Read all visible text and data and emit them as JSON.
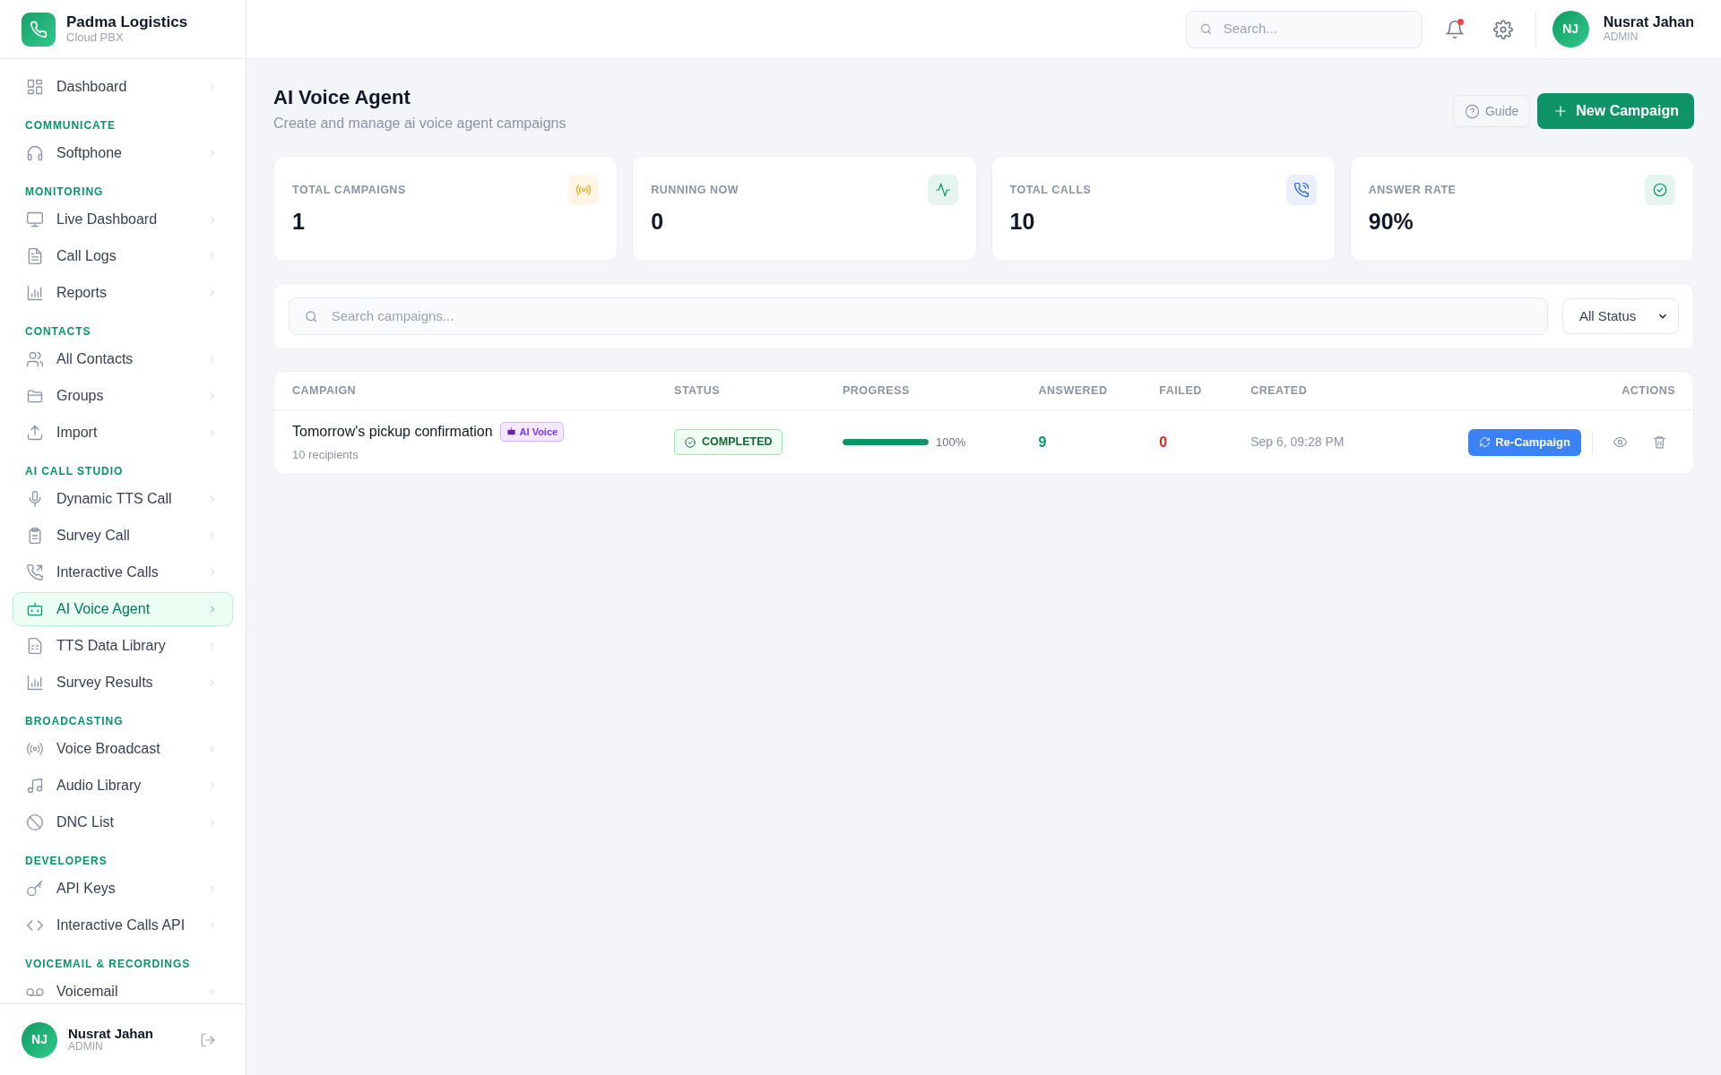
{
  "brand": {
    "name": "Padma Logistics",
    "subtitle": "Cloud PBX"
  },
  "sidebar": {
    "sections": [
      {
        "items": [
          {
            "label": "Dashboard",
            "selected": false
          }
        ]
      },
      {
        "heading": "COMMUNICATE",
        "items": [
          {
            "label": "Softphone",
            "selected": false
          }
        ]
      },
      {
        "heading": "MONITORING",
        "items": [
          {
            "label": "Live Dashboard",
            "selected": false
          },
          {
            "label": "Call Logs",
            "selected": false
          },
          {
            "label": "Reports",
            "selected": false
          }
        ]
      },
      {
        "heading": "CONTACTS",
        "items": [
          {
            "label": "All Contacts",
            "selected": false
          },
          {
            "label": "Groups",
            "selected": false
          },
          {
            "label": "Import",
            "selected": false
          }
        ]
      },
      {
        "heading": "AI CALL STUDIO",
        "items": [
          {
            "label": "Dynamic TTS Call",
            "selected": false
          },
          {
            "label": "Survey Call",
            "selected": false
          },
          {
            "label": "Interactive Calls",
            "selected": false
          },
          {
            "label": "AI Voice Agent",
            "selected": true
          },
          {
            "label": "TTS Data Library",
            "selected": false
          },
          {
            "label": "Survey Results",
            "selected": false
          }
        ]
      },
      {
        "heading": "BROADCASTING",
        "items": [
          {
            "label": "Voice Broadcast",
            "selected": false
          },
          {
            "label": "Audio Library",
            "selected": false
          },
          {
            "label": "DNC List",
            "selected": false
          }
        ]
      },
      {
        "heading": "DEVELOPERS",
        "items": [
          {
            "label": "API Keys",
            "selected": false
          },
          {
            "label": "Interactive Calls API",
            "selected": false
          }
        ]
      },
      {
        "heading": "VOICEMAIL & RECORDINGS",
        "items": [
          {
            "label": "Voicemail",
            "selected": false
          }
        ]
      }
    ],
    "user": {
      "initials": "NJ",
      "name": "Nusrat Jahan",
      "role": "ADMIN"
    }
  },
  "header": {
    "search": {
      "placeholder": "Search..."
    },
    "notifications": {
      "unread": true
    },
    "user": {
      "initials": "NJ",
      "name": "Nusrat Jahan",
      "role": "ADMIN"
    }
  },
  "page": {
    "title": "AI Voice Agent",
    "subtitle": "Create and manage ai voice agent campaigns",
    "buttons": [
      {
        "label": "Guide",
        "kind": "secondary"
      },
      {
        "label": "New Campaign",
        "kind": "primary"
      }
    ]
  },
  "stats": [
    {
      "label": "TOTAL CAMPAIGNS",
      "value": "1",
      "color": "#f59e0b"
    },
    {
      "label": "RUNNING NOW",
      "value": "0",
      "color": "#059669"
    },
    {
      "label": "TOTAL CALLS",
      "value": "10",
      "color": "#2563eb"
    },
    {
      "label": "ANSWER RATE",
      "value": "90%",
      "color": "#059669"
    }
  ],
  "filter": {
    "search": {
      "placeholder": "Search campaigns..."
    },
    "status": "All Status"
  },
  "table": {
    "columns": [
      "CAMPAIGN",
      "STATUS",
      "PROGRESS",
      "ANSWERED",
      "FAILED",
      "CREATED",
      "ACTIONS"
    ],
    "rows": [
      {
        "name": "Tomorrow's pickup confirmation",
        "tag": "AI Voice",
        "recipients": "10 recipients",
        "status": "COMPLETED",
        "level": 1,
        "progress": "100%",
        "answered": "9",
        "failed": "0",
        "created": "Sep 6, 09:28 PM",
        "action": "Re-Campaign"
      }
    ]
  }
}
